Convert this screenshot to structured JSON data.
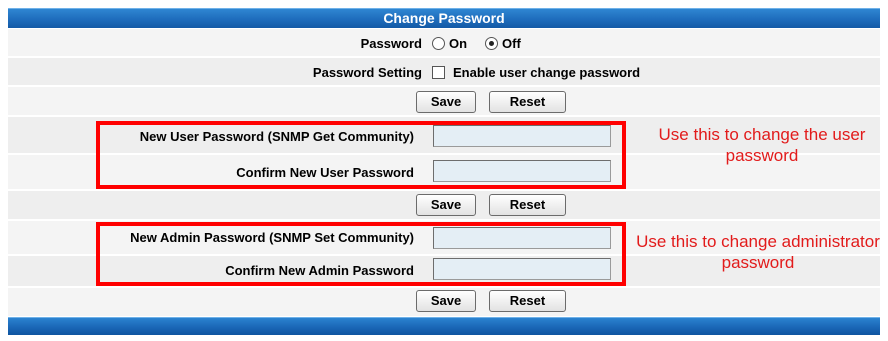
{
  "title": "Change Password",
  "password_row": {
    "label": "Password",
    "on_label": "On",
    "off_label": "Off",
    "selected": "Off"
  },
  "password_setting_row": {
    "label": "Password Setting",
    "checkbox_label": "Enable user change password",
    "checked": false
  },
  "buttons": {
    "save": "Save",
    "reset": "Reset"
  },
  "user_section": {
    "new_label": "New User Password (SNMP Get Community)",
    "confirm_label": "Confirm New User Password",
    "new_value": "",
    "confirm_value": "",
    "note": "Use this to change the user password"
  },
  "admin_section": {
    "new_label": "New Admin Password (SNMP Set Community)",
    "confirm_label": "Confirm New Admin Password",
    "new_value": "",
    "confirm_value": "",
    "note": "Use this to change administrator password"
  },
  "colors": {
    "header": "#1e6cbc",
    "annotation": "#ff0000"
  }
}
